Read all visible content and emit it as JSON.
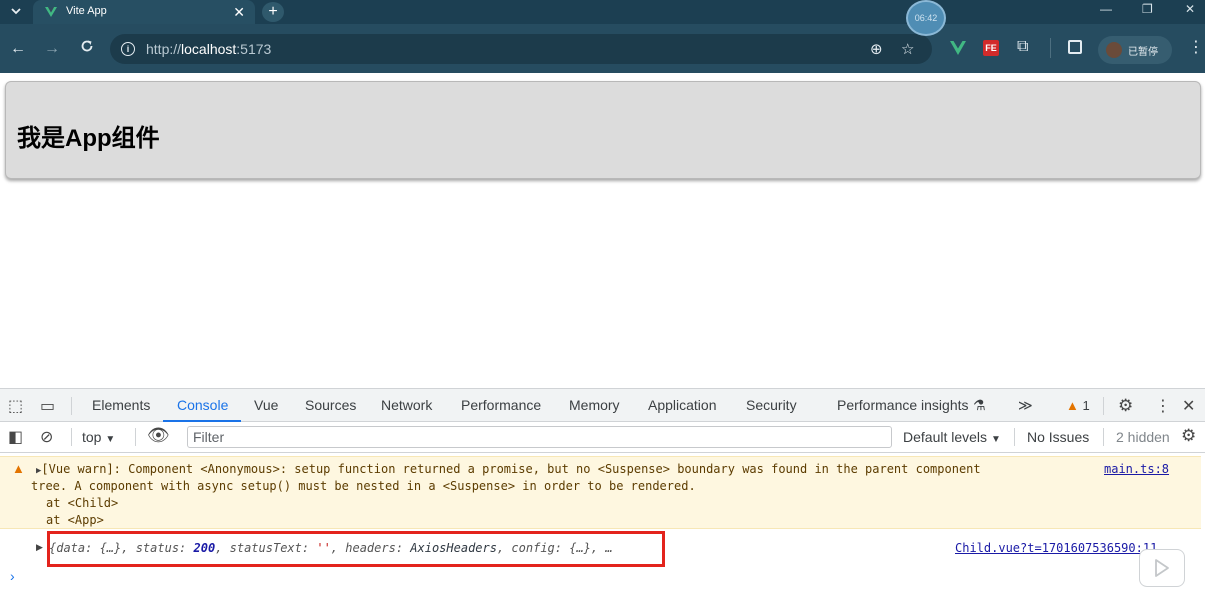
{
  "browser": {
    "tab_title": "Vite App",
    "tab_close_glyph": "✕",
    "new_tab_glyph": "+",
    "recorder_time": "06:42",
    "url_prefix": "http://",
    "url_host": "localhost",
    "url_port": ":5173",
    "profile_label": "已暂停",
    "fe_badge": "FE"
  },
  "page": {
    "heading": "我是App组件"
  },
  "devtools": {
    "tabs": [
      "Elements",
      "Console",
      "Vue",
      "Sources",
      "Network",
      "Performance",
      "Memory",
      "Application",
      "Security",
      "Performance insights"
    ],
    "active_tab": "Console",
    "more_tabs_glyph": "≫",
    "warning_count": "1",
    "context": "top",
    "filter_placeholder": "Filter",
    "levels_label": "Default levels",
    "issues_label": "No Issues",
    "hidden_label": "2 hidden"
  },
  "console": {
    "warning": {
      "line1": "[Vue warn]: Component <Anonymous>: setup function returned a promise, but no <Suspense> boundary was found in the parent component",
      "line2": "tree. A component with async setup() must be nested in a <Suspense> in order to be rendered.",
      "line3": "at <Child>",
      "line4": "at <App>",
      "source": "main.ts:8"
    },
    "log": {
      "p1": "{data: {…}, status: ",
      "status_value": "200",
      "p2": ", statusText: ",
      "status_text_value": "''",
      "p3": ", headers: ",
      "headers_value": "AxiosHeaders",
      "p4": ", config: {…}, …",
      "source": "Child.vue?t=1701607536590:11"
    },
    "prompt_glyph": "›"
  },
  "colors": {
    "chrome_dark": "#1c3f52",
    "toolbar": "#264c60",
    "accent": "#1a73e8",
    "warning_bg": "#fef7e0",
    "highlight_red": "#e3231c"
  }
}
